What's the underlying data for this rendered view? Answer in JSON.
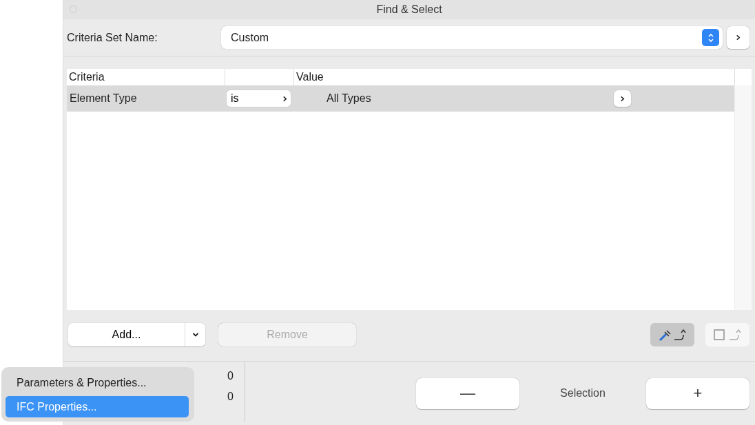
{
  "window": {
    "title": "Find & Select"
  },
  "criteria_set": {
    "label": "Criteria Set Name:",
    "value": "Custom"
  },
  "table": {
    "columns": [
      "Criteria",
      "",
      "Value"
    ],
    "rows": [
      {
        "criteria": "Element Type",
        "operator": "is",
        "value": "All Types",
        "selected": true
      }
    ]
  },
  "actions": {
    "add": "Add...",
    "remove": {
      "label": "Remove",
      "disabled": true
    }
  },
  "tools": [
    {
      "kind": "eyedropper",
      "selected": true
    },
    {
      "kind": "marquee",
      "selected": false
    }
  ],
  "counts": [
    "0",
    "0"
  ],
  "selection": {
    "minus": "—",
    "label": "Selection",
    "plus": "+"
  },
  "menu": {
    "items": [
      {
        "label": "Parameters & Properties...",
        "selected": false
      },
      {
        "label": "IFC Properties...",
        "selected": true
      }
    ]
  }
}
